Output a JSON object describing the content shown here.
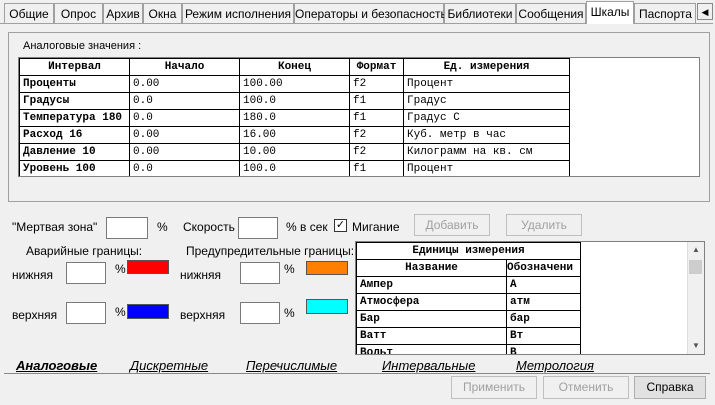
{
  "top_tabs": [
    "Общие",
    "Опрос",
    "Архив",
    "Окна",
    "Режим исполнения",
    "Операторы и безопасность",
    "Библиотеки",
    "Сообщения",
    "Шкалы",
    "Паспорта"
  ],
  "active_top_tab": "Шкалы",
  "analog_group_title": "Аналоговые значения :",
  "analog_table": {
    "headers": [
      "Интервал",
      "Начало",
      "Конец",
      "Формат",
      "Ед. измерения"
    ],
    "rows": [
      [
        "Проценты",
        "0.00",
        "100.00",
        "f2",
        "Процент"
      ],
      [
        "Градусы",
        "0.0",
        "100.0",
        "f1",
        "Градус"
      ],
      [
        "Температура 180",
        "0.0",
        "180.0",
        "f1",
        "Градус С"
      ],
      [
        "Расход 16",
        "0.00",
        "16.00",
        "f2",
        "Куб. метр в час"
      ],
      [
        "Давление 10",
        "0.00",
        "10.00",
        "f2",
        "Килограмм на кв. см"
      ],
      [
        "Уровень 100",
        "0.0",
        "100.0",
        "f1",
        "Процент"
      ]
    ]
  },
  "deadzone_label": "\"Мертвая зона\"",
  "deadzone_value": "",
  "percent_sign": "%",
  "speed_label": "Скорость",
  "speed_value": "",
  "speed_unit": "% в сек",
  "blink_label": "Мигание",
  "blink_checked": true,
  "add_button": "Добавить",
  "delete_button": "Удалить",
  "alarm_limits_label": "Аварийные границы:",
  "warning_limits_label": "Предупредительные границы:",
  "lower_label": "нижняя",
  "upper_label": "верхняя",
  "alarm_lower_value": "",
  "alarm_upper_value": "",
  "warning_lower_value": "",
  "warning_upper_value": "",
  "colors": {
    "alarm_lower": "#ff0000",
    "alarm_upper": "#0000ff",
    "warning_lower": "#ff8000",
    "warning_upper": "#00ffff"
  },
  "units_table": {
    "title": "Единицы измерения",
    "headers": [
      "Название",
      "Обозначени"
    ],
    "rows": [
      [
        "Ампер",
        "А"
      ],
      [
        "Атмосфера",
        "атм"
      ],
      [
        "Бар",
        "бар"
      ],
      [
        "Ватт",
        "Вт"
      ],
      [
        "Вольт",
        "В"
      ]
    ]
  },
  "bottom_tabs": [
    "Аналоговые",
    "Дискретные",
    "Перечислимые",
    "Интервальные",
    "Метрология"
  ],
  "active_bottom_tab": "Аналоговые",
  "apply_button": "Применить",
  "cancel_button": "Отменить",
  "help_button": "Справка"
}
